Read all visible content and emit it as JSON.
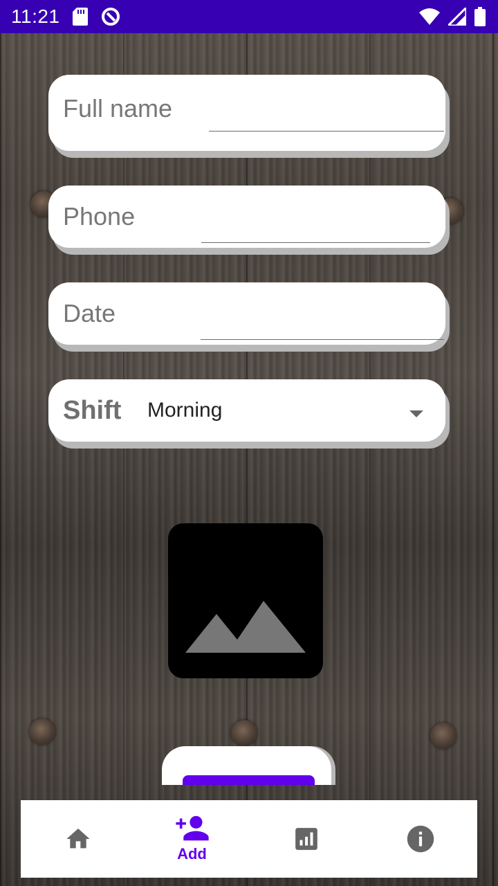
{
  "status_bar": {
    "time": "11:21",
    "icons": [
      "sd-card-icon",
      "data-saver-icon",
      "wifi-icon",
      "signal-icon",
      "battery-icon"
    ]
  },
  "form": {
    "full_name": {
      "label": "Full  name",
      "value": ""
    },
    "phone": {
      "label": "Phone",
      "value": ""
    },
    "date": {
      "label": "Date",
      "value": ""
    },
    "shift": {
      "label": "Shift",
      "selected": "Morning"
    }
  },
  "image_placeholder": {
    "icon": "image-icon"
  },
  "bottom_nav": {
    "items": [
      {
        "icon": "home-icon",
        "label": ""
      },
      {
        "icon": "person-add-icon",
        "label": "Add",
        "active": true
      },
      {
        "icon": "bar-chart-icon",
        "label": ""
      },
      {
        "icon": "info-icon",
        "label": ""
      }
    ],
    "active_color": "#6200ee",
    "inactive_color": "#666666"
  },
  "colors": {
    "status_bar": "#3700b3",
    "primary": "#6200ee"
  }
}
